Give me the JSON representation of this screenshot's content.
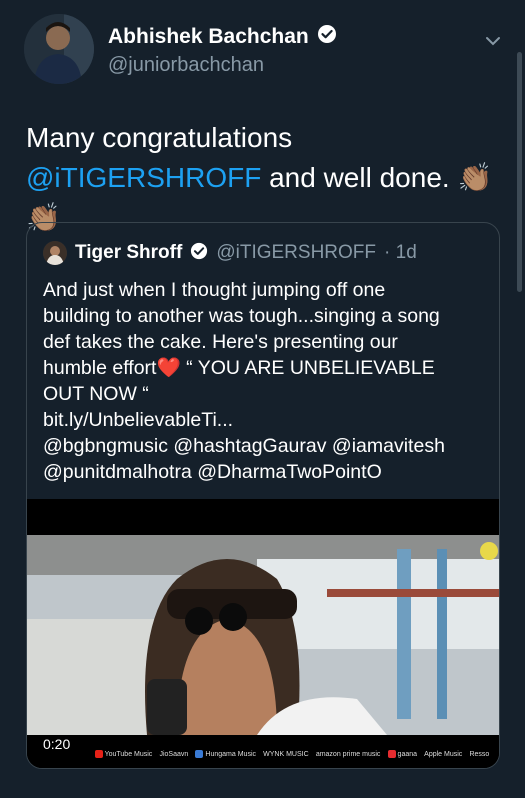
{
  "author": {
    "name": "Abhishek Bachchan",
    "handle": "@juniorbachchan",
    "verified_icon": "verified-badge-icon",
    "menu_icon": "chevron-down-icon"
  },
  "tweet": {
    "text_start": "Many congratulations",
    "mention": "@iTIGERSHROFF",
    "text_end": " and well done. 👏🏽👏🏽"
  },
  "quoted": {
    "name": "Tiger Shroff",
    "handle": "@iTIGERSHROFF",
    "time": "· 1d",
    "lines": [
      "And just when I thought jumping off one",
      "building to another was tough...singing a song",
      "def takes the cake. Here's presenting our",
      "humble effort❤️  “ YOU ARE UNBELIEVABLE",
      "OUT NOW “",
      "bit.ly/UnbelievableTi...",
      "@bgbngmusic @hashtagGaurav @iamavitesh",
      "@punitdmalhotra @DharmaTwoPointO"
    ],
    "video_time": "0:20",
    "logos": [
      "YouTube Music",
      "JioSaavn",
      "Hungama Music",
      "WYNK MUSIC",
      "amazon prime music",
      "gaana",
      "Apple Music",
      "Resso"
    ]
  },
  "colors": {
    "background": "#15202b",
    "accent": "#1da1f2",
    "secondary_text": "#8899a6",
    "border": "#38444d"
  }
}
